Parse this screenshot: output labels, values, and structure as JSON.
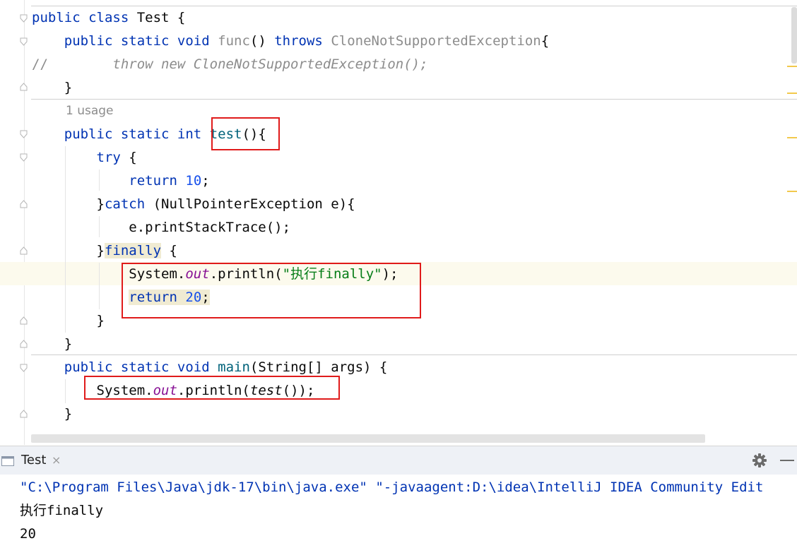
{
  "editor": {
    "line1": {
      "kw": "public class",
      "name": " Test {"
    },
    "line2": {
      "indent": "    ",
      "kw": "public static void",
      "fn": "func",
      "paren": "() ",
      "throws": "throws",
      "exc": "CloneNotSupportedException",
      "brace": "{"
    },
    "line3": {
      "comment_slashes": "//",
      "comment_body": "        throw new CloneNotSupportedException();"
    },
    "line4": {
      "text": "    }"
    },
    "usage": "1 usage",
    "line5": {
      "indent": "    ",
      "kw": "public static int",
      "fn": "test",
      "rest": "(){"
    },
    "line6": {
      "indent": "        ",
      "kw": "try",
      "rest": " {"
    },
    "line7": {
      "indent": "            ",
      "kw": "return",
      "num": "10",
      "rest": ";"
    },
    "line8": {
      "indent": "        ",
      "brace": "}",
      "kw": "catch",
      "rest": " (NullPointerException e){"
    },
    "line9": {
      "text": "            e.printStackTrace();"
    },
    "line10": {
      "indent": "        ",
      "brace": "}",
      "kw": "finally",
      "rest": " {"
    },
    "line11": {
      "indent": "            ",
      "sys": "System.",
      "field": "out",
      "call": ".println(",
      "str": "\"执行finally\"",
      "rest": ");"
    },
    "line12": {
      "indent": "            ",
      "kw": "return",
      "num": "20",
      "rest": ";"
    },
    "line13": {
      "text": "        }"
    },
    "line14": {
      "text": "    }"
    },
    "line15": {
      "indent": "    ",
      "kw": "public static void",
      "fn": "main",
      "rest": "(String[] args) {"
    },
    "line16": {
      "indent": "        ",
      "sys": "System.",
      "field": "out",
      "call": ".println(",
      "test": "test",
      "rest": "());"
    },
    "line17": {
      "text": "    }"
    }
  },
  "run_panel": {
    "tab_label": "Test",
    "tab_close": "×",
    "icons": [
      "console-tab-icon",
      "gear-icon",
      "minimize-icon"
    ]
  },
  "console": {
    "command": "\"C:\\Program Files\\Java\\jdk-17\\bin\\java.exe\" \"-javaagent:D:\\idea\\IntelliJ IDEA Community Edit",
    "output": [
      "执行finally",
      "20"
    ]
  },
  "colors": {
    "keyword": "#0033b3",
    "method": "#00627a",
    "number": "#1750eb",
    "string": "#067d17",
    "field": "#871094",
    "comment": "#8c8c8c",
    "annotation_box": "#e01b1b"
  }
}
